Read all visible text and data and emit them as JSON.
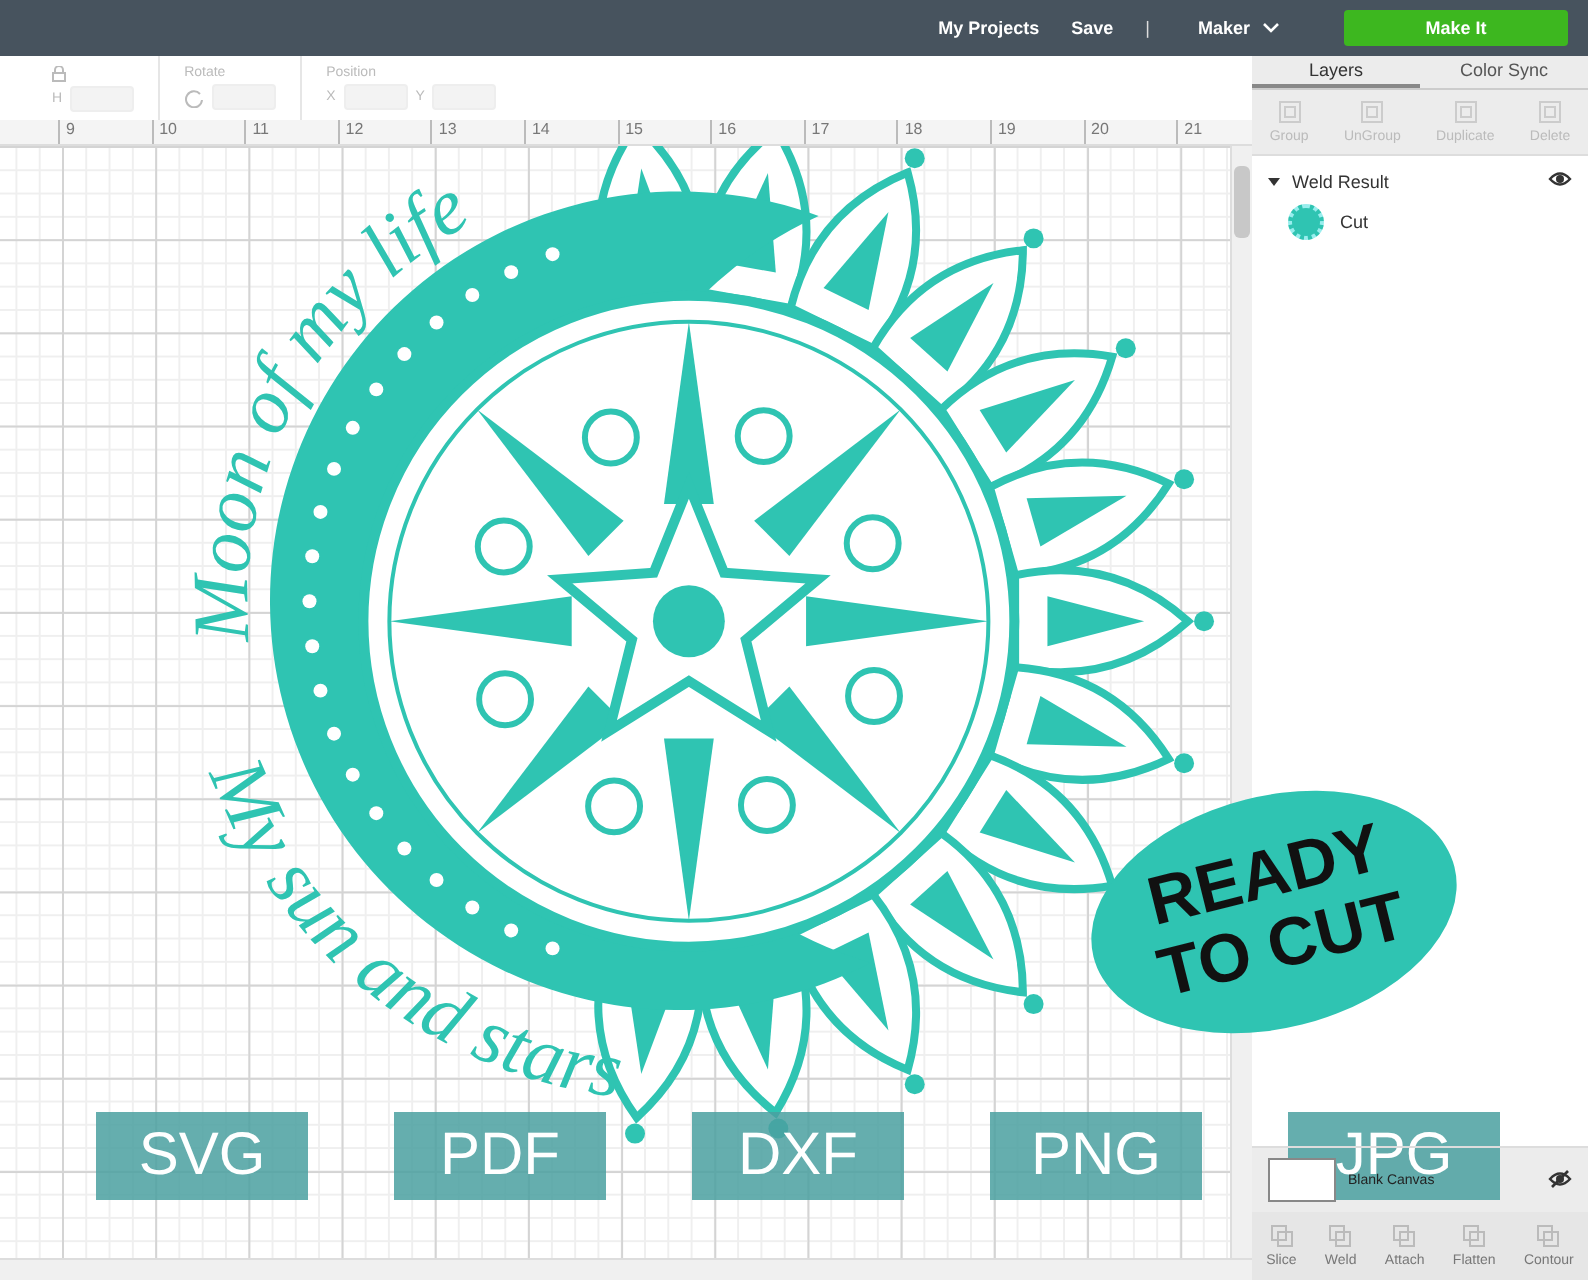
{
  "top_bar": {
    "links": [
      "My Projects",
      "Save"
    ],
    "separator": "|",
    "machine": "Maker",
    "make_it": "Make It"
  },
  "toolbar": {
    "size": {
      "h_label": "H"
    },
    "rotate": {
      "label": "Rotate"
    },
    "position": {
      "label": "Position",
      "x_label": "X",
      "y_label": "Y"
    }
  },
  "ruler": [
    "9",
    "10",
    "11",
    "12",
    "13",
    "14",
    "15",
    "16",
    "17",
    "18",
    "19",
    "20",
    "21"
  ],
  "design": {
    "top_text": "Moon of my life",
    "bottom_text": "My sun and stars"
  },
  "formats": [
    "SVG",
    "PDF",
    "DXF",
    "PNG",
    "JPG"
  ],
  "ready_badge": {
    "lines": [
      "READY",
      "TO CUT"
    ]
  },
  "panel": {
    "tabs": [
      {
        "label": "Layers",
        "selected": true
      },
      {
        "label": "Color Sync",
        "selected": false
      }
    ],
    "actions": [
      "Group",
      "UnGroup",
      "Duplicate",
      "Delete"
    ],
    "layers": [
      {
        "name": "Weld Result",
        "expanded": true,
        "visible": true,
        "children": [
          {
            "name": "Cut"
          }
        ]
      }
    ],
    "blank_canvas": {
      "label": "Blank Canvas",
      "visible": false
    },
    "bottom_actions": [
      "Slice",
      "Weld",
      "Attach",
      "Flatten",
      "Contour"
    ]
  }
}
